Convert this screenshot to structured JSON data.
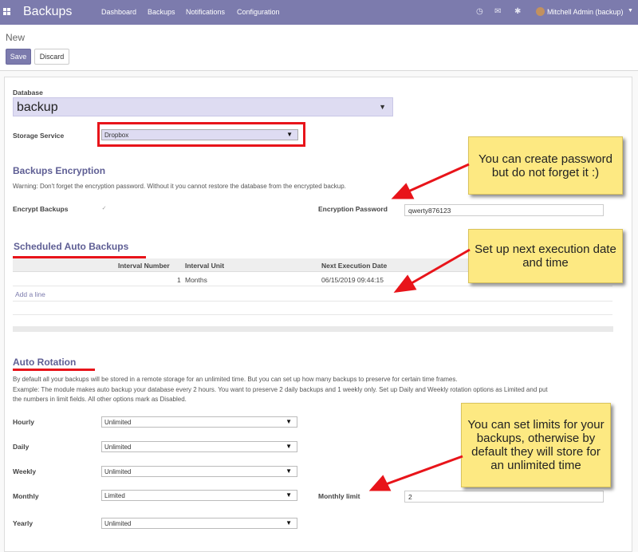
{
  "navbar": {
    "app_title": "Backups",
    "menu": [
      "Dashboard",
      "Backups",
      "Notifications",
      "Configuration"
    ],
    "user": "Mitchell Admin (backup)",
    "icons": [
      "apps-icon",
      "clock-icon",
      "chat-icon",
      "bug-icon",
      "avatar",
      "caret-down-icon"
    ]
  },
  "control_panel": {
    "breadcrumb": "New",
    "save_label": "Save",
    "discard_label": "Discard"
  },
  "form": {
    "database_label": "Database",
    "database_value": "backup",
    "storage_service_label": "Storage Service",
    "storage_service_value": "Dropbox",
    "encryption": {
      "title": "Backups Encryption",
      "warning": "Warning: Don't forget the encryption password. Without it you cannot restore the database from the encrypted backup.",
      "encrypt_label": "Encrypt Backups",
      "encrypt_checked": true,
      "password_label": "Encryption Password",
      "password_value": "qwerty876123"
    },
    "scheduled": {
      "title": "Scheduled Auto Backups",
      "columns": [
        "Interval Number",
        "Interval Unit",
        "Next Execution Date"
      ],
      "rows": [
        {
          "interval_number": "1",
          "interval_unit": "Months",
          "next_execution_date": "06/15/2019 09:44:15"
        }
      ],
      "add_line": "Add a line"
    },
    "rotation": {
      "title": "Auto Rotation",
      "description1": "By default all your backups will be stored in a remote storage for an unlimited time. But you can set up how many backups to preserve for certain time frames.",
      "description2": "Example: The module makes auto backup your database every 2 hours. You want to preserve 2 daily backups and 1 weekly only. Set up Daily and Weekly rotation options as Limited and put",
      "description3": "the numbers in limit fields. All other options mark as Disabled.",
      "hourly_label": "Hourly",
      "hourly_value": "Unlimited",
      "daily_label": "Daily",
      "daily_value": "Unlimited",
      "weekly_label": "Weekly",
      "weekly_value": "Unlimited",
      "monthly_label": "Monthly",
      "monthly_value": "Limited",
      "monthly_limit_label": "Monthly limit",
      "monthly_limit_value": "2",
      "yearly_label": "Yearly",
      "yearly_value": "Unlimited"
    }
  },
  "callouts": {
    "password": "You can create password but do not forget it :)",
    "execution": "Set up next execution date and time",
    "limits": "You can set  limits for your backups, otherwise by default they will store for an unlimited time"
  },
  "colors": {
    "navbar": "#7c7bad",
    "section_title": "#5e5e94",
    "annotation_red": "#e8141a",
    "callout_yellow": "#fde982"
  }
}
